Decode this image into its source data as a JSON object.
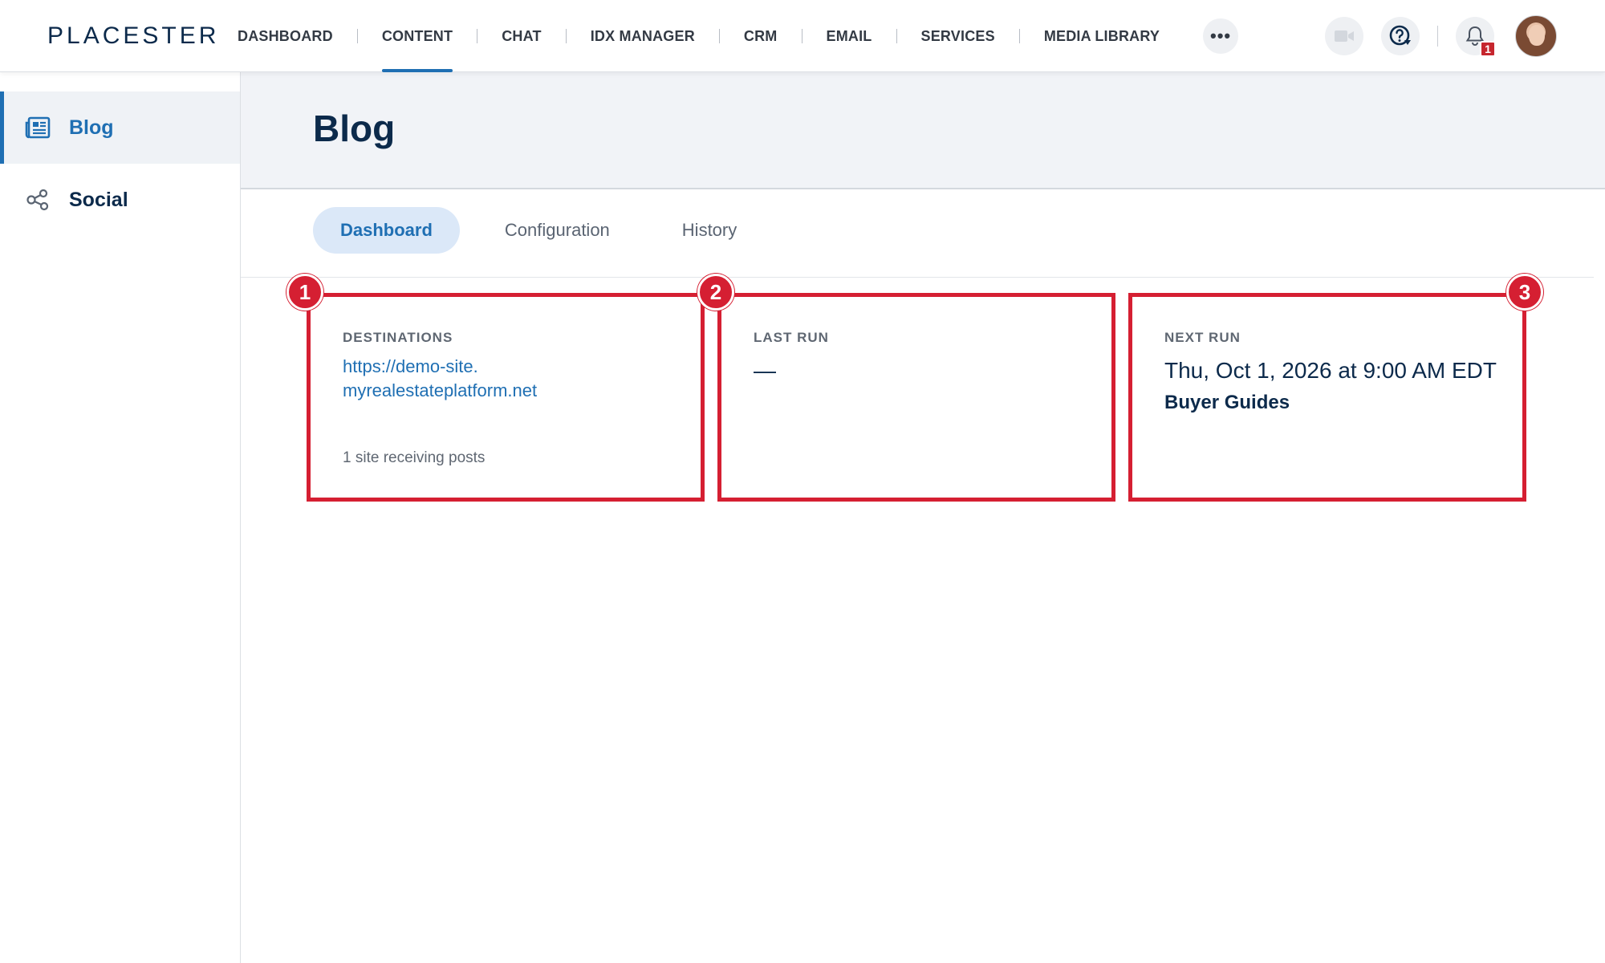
{
  "brand": "PLACESTER",
  "nav": {
    "items": [
      {
        "label": "DASHBOARD"
      },
      {
        "label": "CONTENT",
        "active": true
      },
      {
        "label": "CHAT"
      },
      {
        "label": "IDX MANAGER"
      },
      {
        "label": "CRM"
      },
      {
        "label": "EMAIL"
      },
      {
        "label": "SERVICES"
      },
      {
        "label": "MEDIA LIBRARY"
      }
    ],
    "more": "•••",
    "notification_count": "1",
    "icons": {
      "video": "video-camera-icon",
      "help": "help-icon",
      "notifications": "bell-icon",
      "more": "more-dots-icon"
    }
  },
  "sidebar": {
    "items": [
      {
        "label": "Blog",
        "icon": "newspaper-icon",
        "active": true
      },
      {
        "label": "Social",
        "icon": "share-icon"
      }
    ]
  },
  "page": {
    "title": "Blog"
  },
  "tabs": [
    {
      "label": "Dashboard",
      "active": true
    },
    {
      "label": "Configuration"
    },
    {
      "label": "History"
    }
  ],
  "cards": {
    "destinations": {
      "marker": "1",
      "label": "DESTINATIONS",
      "url_line1": "https://demo-site.",
      "url_line2": "myrealestateplatform.net",
      "sub": "1 site receiving posts"
    },
    "last_run": {
      "marker": "2",
      "label": "LAST RUN",
      "value": "—"
    },
    "next_run": {
      "marker": "3",
      "label": "NEXT RUN",
      "date": "Thu, Oct 1, 2026 at 9:00 AM EDT",
      "topic": "Buyer Guides"
    }
  },
  "colors": {
    "accent": "#1f6fb3",
    "brand_text": "#0c2a4b",
    "highlight_border": "#d51f32",
    "badge": "#c6262e"
  }
}
